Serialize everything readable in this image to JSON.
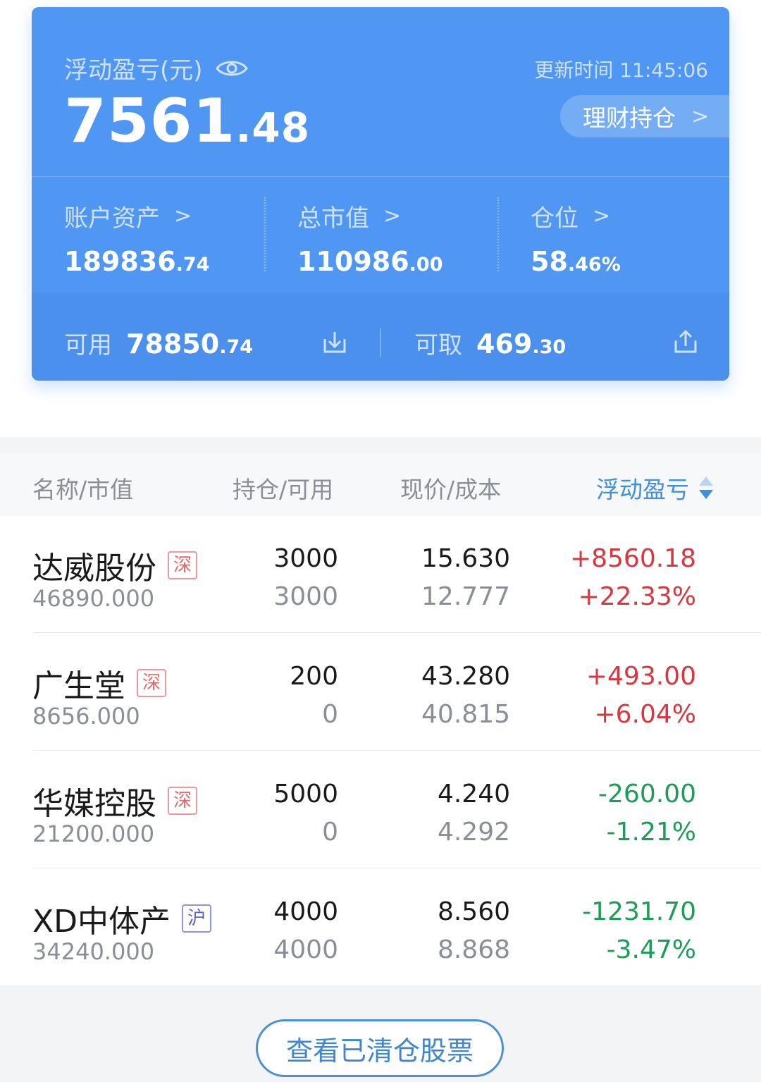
{
  "summary": {
    "floating_pl_label": "浮动盈亏(元)",
    "floating_pl_int": "7561",
    "floating_pl_dec": ".48",
    "update_label": "更新时间",
    "update_time": "11:45:06",
    "licai_label": "理财持仓",
    "account_assets_label": "账户资产",
    "account_assets_int": "189836",
    "account_assets_dec": ".74",
    "market_value_label": "总市值",
    "market_value_int": "110986",
    "market_value_dec": ".00",
    "position_label": "仓位",
    "position_int": "58",
    "position_dec": ".46%",
    "available_label": "可用",
    "available_int": "78850",
    "available_dec": ".74",
    "withdrawable_label": "可取",
    "withdrawable_int": "469",
    "withdrawable_dec": ".30"
  },
  "table": {
    "headers": [
      "名称/市值",
      "持仓/可用",
      "现价/成本",
      "浮动盈亏"
    ],
    "rows": [
      {
        "name": "达威股份",
        "market": "深",
        "market_value": "46890.000",
        "holding": "3000",
        "available": "3000",
        "price": "15.630",
        "cost": "12.777",
        "pl": "+8560.18",
        "pl_pct": "+22.33%",
        "direction": "up"
      },
      {
        "name": "广生堂",
        "market": "深",
        "market_value": "8656.000",
        "holding": "200",
        "available": "0",
        "price": "43.280",
        "cost": "40.815",
        "pl": "+493.00",
        "pl_pct": "+6.04%",
        "direction": "up"
      },
      {
        "name": "华媒控股",
        "market": "深",
        "market_value": "21200.000",
        "holding": "5000",
        "available": "0",
        "price": "4.240",
        "cost": "4.292",
        "pl": "-260.00",
        "pl_pct": "-1.21%",
        "direction": "down"
      },
      {
        "name": "XD中体产",
        "market": "沪",
        "market_value": "34240.000",
        "holding": "4000",
        "available": "4000",
        "price": "8.560",
        "cost": "8.868",
        "pl": "-1231.70",
        "pl_pct": "-3.47%",
        "direction": "down"
      }
    ]
  },
  "footer": {
    "cleared_button": "查看已清仓股票"
  },
  "colors": {
    "card": "#4f97f2",
    "up": "#d9373f",
    "down": "#1d9c57",
    "accent": "#3f8fe0"
  },
  "icons": {
    "eye": "eye-icon",
    "transfer_in": "download-icon",
    "transfer_out": "upload-icon",
    "sort": "sort-icon"
  }
}
